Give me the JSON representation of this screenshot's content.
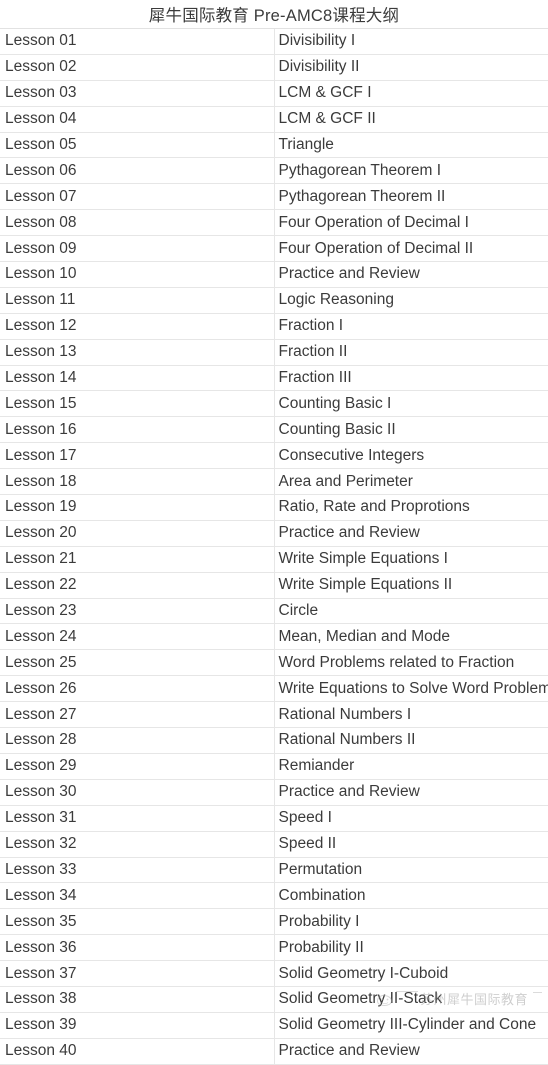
{
  "document": {
    "title": "犀牛国际教育 Pre-AMC8课程大纲",
    "background_color": "#ffffff",
    "text_color": "#3b3b3b",
    "border_color": "#e6e6e6"
  },
  "watermark": {
    "text": "苏州犀牛国际教育",
    "logo_icon": "rhino-logo-icon",
    "color": "#9a9a9a"
  },
  "table": {
    "rows": [
      {
        "lesson": "Lesson 01",
        "topic": "Divisibility I"
      },
      {
        "lesson": "Lesson 02",
        "topic": "Divisibility II"
      },
      {
        "lesson": "Lesson 03",
        "topic": "LCM & GCF I"
      },
      {
        "lesson": "Lesson 04",
        "topic": "LCM & GCF II"
      },
      {
        "lesson": "Lesson 05",
        "topic": "Triangle"
      },
      {
        "lesson": "Lesson 06",
        "topic": "Pythagorean Theorem I"
      },
      {
        "lesson": "Lesson 07",
        "topic": "Pythagorean Theorem II"
      },
      {
        "lesson": "Lesson 08",
        "topic": "Four Operation of Decimal I"
      },
      {
        "lesson": "Lesson 09",
        "topic": "Four Operation of Decimal II"
      },
      {
        "lesson": "Lesson 10",
        "topic": "Practice and Review"
      },
      {
        "lesson": "Lesson 11",
        "topic": "Logic Reasoning"
      },
      {
        "lesson": "Lesson 12",
        "topic": "Fraction I"
      },
      {
        "lesson": "Lesson 13",
        "topic": "Fraction II"
      },
      {
        "lesson": "Lesson 14",
        "topic": "Fraction III"
      },
      {
        "lesson": "Lesson 15",
        "topic": "Counting Basic I"
      },
      {
        "lesson": "Lesson 16",
        "topic": "Counting Basic II"
      },
      {
        "lesson": "Lesson 17",
        "topic": "Consecutive Integers"
      },
      {
        "lesson": "Lesson 18",
        "topic": "Area and Perimeter"
      },
      {
        "lesson": "Lesson 19",
        "topic": "Ratio, Rate and Proprotions"
      },
      {
        "lesson": "Lesson 20",
        "topic": "Practice and Review"
      },
      {
        "lesson": "Lesson 21",
        "topic": "Write Simple Equations I"
      },
      {
        "lesson": "Lesson 22",
        "topic": "Write Simple Equations II"
      },
      {
        "lesson": "Lesson 23",
        "topic": "Circle"
      },
      {
        "lesson": "Lesson 24",
        "topic": "Mean, Median and Mode"
      },
      {
        "lesson": "Lesson 25",
        "topic": "Word Problems related to Fraction"
      },
      {
        "lesson": "Lesson 26",
        "topic": "Write Equations to Solve Word Problems"
      },
      {
        "lesson": "Lesson 27",
        "topic": "Rational Numbers I"
      },
      {
        "lesson": "Lesson 28",
        "topic": "Rational Numbers II"
      },
      {
        "lesson": "Lesson 29",
        "topic": "Remiander"
      },
      {
        "lesson": "Lesson 30",
        "topic": "Practice and Review"
      },
      {
        "lesson": "Lesson 31",
        "topic": "Speed I"
      },
      {
        "lesson": "Lesson 32",
        "topic": "Speed II"
      },
      {
        "lesson": "Lesson 33",
        "topic": "Permutation"
      },
      {
        "lesson": "Lesson 34",
        "topic": "Combination"
      },
      {
        "lesson": "Lesson 35",
        "topic": "Probability I"
      },
      {
        "lesson": "Lesson 36",
        "topic": "Probability II"
      },
      {
        "lesson": "Lesson 37",
        "topic": "Solid Geometry I-Cuboid"
      },
      {
        "lesson": "Lesson 38",
        "topic": "Solid Geometry II-Stack"
      },
      {
        "lesson": "Lesson 39",
        "topic": "Solid Geometry III-Cylinder and Cone"
      },
      {
        "lesson": "Lesson 40",
        "topic": "Practice and Review"
      }
    ]
  }
}
